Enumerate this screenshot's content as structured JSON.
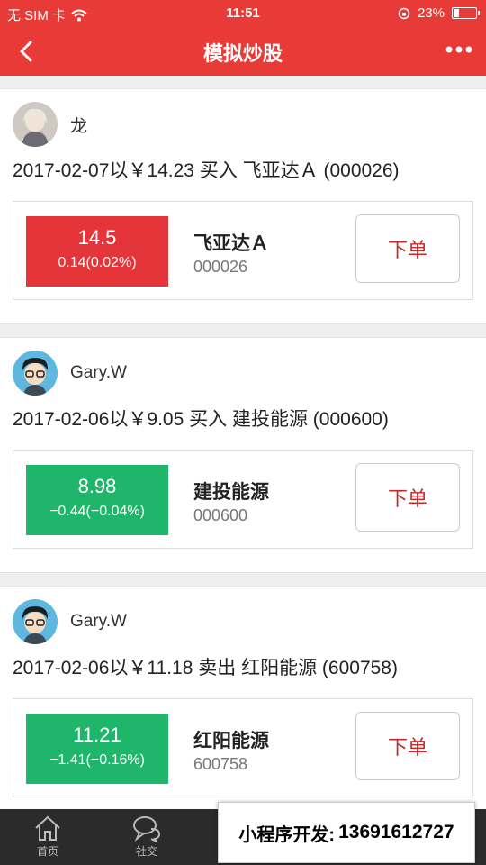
{
  "status_bar": {
    "carrier": "无 SIM 卡",
    "time": "11:51",
    "battery_level": "23%",
    "battery_fraction": 0.23,
    "icons": [
      "wifi-icon",
      "rotation-lock-icon",
      "battery-icon"
    ]
  },
  "nav": {
    "title": "模拟炒股",
    "back_icon": "chevron-left-icon",
    "more_icon": "more-dots-icon"
  },
  "posts": [
    {
      "user": "龙",
      "description": "2017-02-07以￥14.23 买入 飞亚达Ａ (000026)",
      "stock": {
        "price": "14.5",
        "change": "0.14(0.02%)",
        "name": "飞亚达Ａ",
        "code": "000026",
        "color": "#e4353b"
      },
      "order_label": "下单"
    },
    {
      "user": "Gary.W",
      "description": "2017-02-06以￥9.05 买入 建投能源 (000600)",
      "stock": {
        "price": "8.98",
        "change": "−0.44(−0.04%)",
        "name": "建投能源",
        "code": "000600",
        "color": "#1fb56b"
      },
      "order_label": "下单"
    },
    {
      "user": "Gary.W",
      "description": "2017-02-06以￥11.18 卖出 红阳能源 (600758)",
      "stock": {
        "price": "11.21",
        "change": "−1.41(−0.16%)",
        "name": "红阳能源",
        "code": "600758",
        "color": "#1fb56b"
      },
      "order_label": "下单"
    }
  ],
  "tabbar": {
    "tabs": [
      {
        "label": "首页",
        "icon": "home-icon"
      },
      {
        "label": "社交",
        "icon": "chat-icon"
      }
    ]
  },
  "watermark": {
    "label": "小程序开发:",
    "phone": "13691612727"
  }
}
